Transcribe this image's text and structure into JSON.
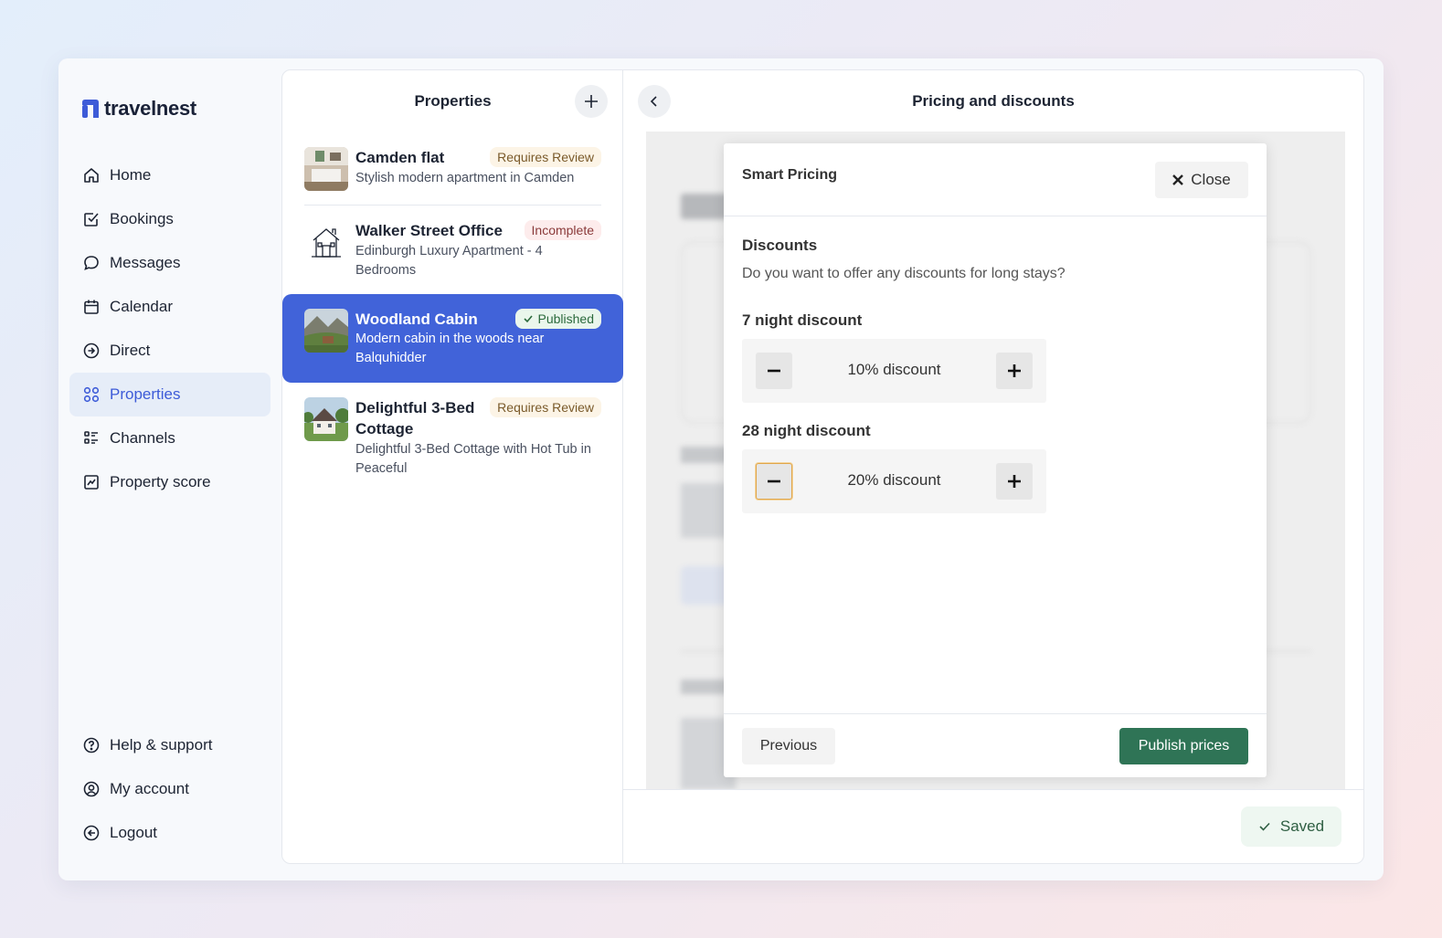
{
  "brand": {
    "name": "travelnest"
  },
  "nav": {
    "items": [
      {
        "label": "Home",
        "icon": "home-icon"
      },
      {
        "label": "Bookings",
        "icon": "checkbox-icon"
      },
      {
        "label": "Messages",
        "icon": "chat-bubble-icon"
      },
      {
        "label": "Calendar",
        "icon": "calendar-icon"
      },
      {
        "label": "Direct",
        "icon": "arrow-circle-icon"
      },
      {
        "label": "Properties",
        "icon": "grid-icon"
      },
      {
        "label": "Channels",
        "icon": "list-icon"
      },
      {
        "label": "Property score",
        "icon": "chart-icon"
      }
    ],
    "bottom": [
      {
        "label": "Help & support",
        "icon": "help-icon"
      },
      {
        "label": "My account",
        "icon": "user-circle-icon"
      },
      {
        "label": "Logout",
        "icon": "logout-icon"
      }
    ],
    "active": "Properties"
  },
  "properties": {
    "title": "Properties",
    "items": [
      {
        "name": "Camden flat",
        "desc": "Stylish modern apartment in Camden",
        "status": "Requires Review"
      },
      {
        "name": "Walker Street Office",
        "desc": "Edinburgh Luxury Apartment - 4 Bedrooms",
        "status": "Incomplete"
      },
      {
        "name": "Woodland Cabin",
        "desc": "Modern cabin in the woods near Balquhidder",
        "status": "Published"
      },
      {
        "name": "Delightful 3-Bed Cottage",
        "desc": "Delightful 3-Bed Cottage with Hot Tub in Peaceful",
        "status": "Requires Review"
      }
    ]
  },
  "page": {
    "title": "Pricing and discounts",
    "saved_label": "Saved"
  },
  "modal": {
    "title": "Smart Pricing",
    "close_label": "Close",
    "section_title": "Discounts",
    "section_sub": "Do you want to offer any discounts for long stays?",
    "discount7": {
      "label": "7 night discount",
      "value": "10% discount"
    },
    "discount28": {
      "label": "28 night discount",
      "value": "20% discount"
    },
    "previous_label": "Previous",
    "publish_label": "Publish prices"
  },
  "colors": {
    "accent": "#4163d9",
    "publish": "#2f7456",
    "nav_active_bg": "#e6edf8"
  }
}
